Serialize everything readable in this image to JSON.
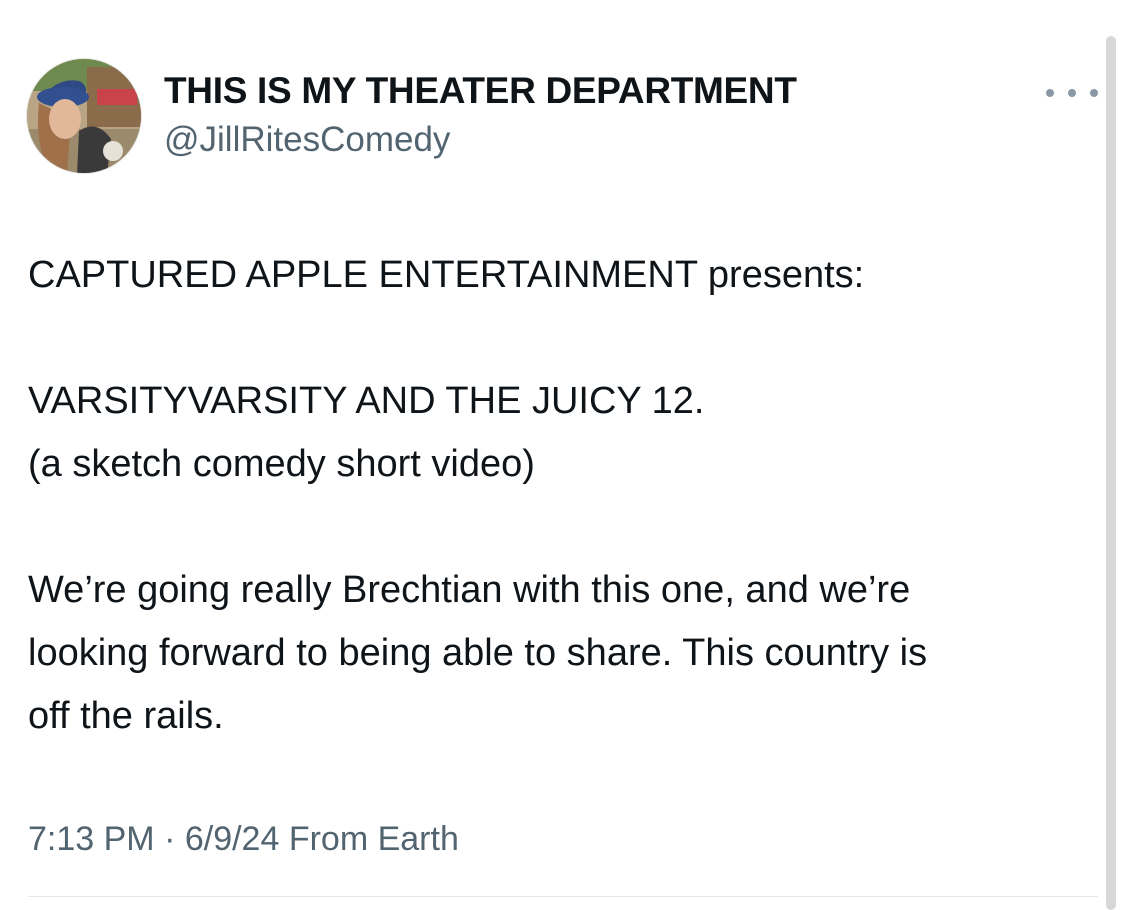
{
  "author": {
    "display_name": "THIS IS MY THEATER DEPARTMENT",
    "handle": "@JillRitesComedy"
  },
  "tweet": {
    "line_1": "CAPTURED APPLE ENTERTAINMENT presents:",
    "line_2": "VARSITYVARSITY AND THE JUICY 12.",
    "line_3": "(a sketch comedy short video)",
    "line_4": "We’re going really Brechtian with this one, and we’re",
    "line_5": "looking forward to being able to share. This country is",
    "line_6": "off the rails."
  },
  "meta": {
    "time": "7:13 PM",
    "separator": " · ",
    "date": "6/9/24",
    "source": " From Earth"
  },
  "icons": {
    "more": "more-horizontal-icon"
  },
  "colors": {
    "text": "#0f1419",
    "secondary": "#536471",
    "divider": "#e1e8ed"
  }
}
